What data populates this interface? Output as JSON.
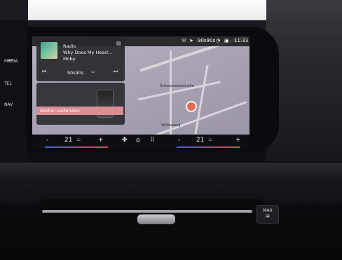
{
  "left_controls": {
    "media_label": "MEDIA",
    "tel_label": "TEL",
    "nav_label": "NAV"
  },
  "status_bar": {
    "station": "90s90s",
    "time": "11:33"
  },
  "media_widget": {
    "source": "Radio",
    "track_title": "Why Does My Heart...",
    "artist": "Moby",
    "station": "90s90s"
  },
  "phone_widget": {
    "action_label": "Telefon verbinden"
  },
  "map": {
    "street_1": "Schwarzwaldstraße",
    "street_2": "Wildenweg"
  },
  "climate": {
    "driver_temp": "21",
    "passenger_temp": "21",
    "minus": "-",
    "plus": "+"
  },
  "console": {
    "max_label": "MAX"
  },
  "colors": {
    "accent_phone": "#d98d95",
    "map_bg": "#b7b1bf",
    "heat_red": "#e0474f",
    "cool_blue": "#3a63c9"
  }
}
